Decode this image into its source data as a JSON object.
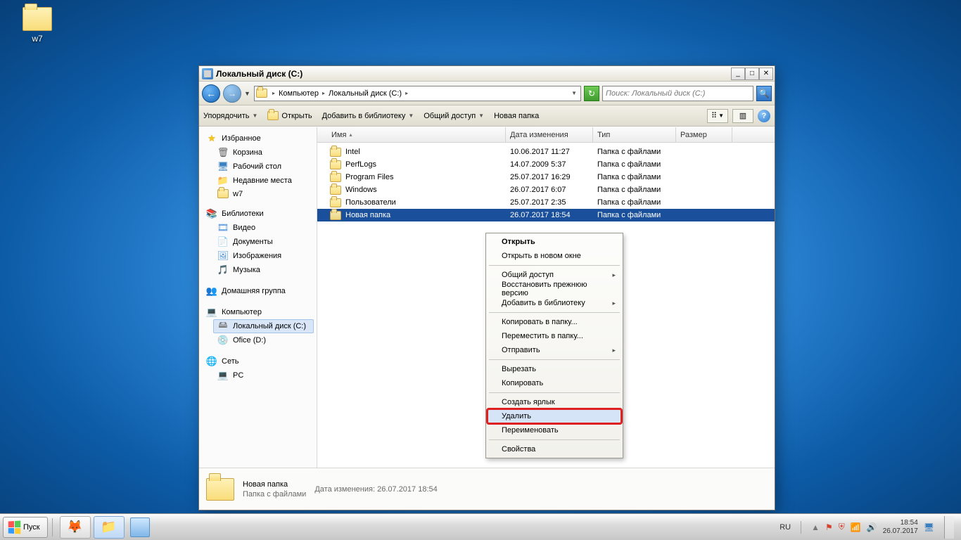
{
  "desktop": {
    "icon_label": "w7"
  },
  "window": {
    "title": "Локальный диск (C:)",
    "breadcrumb": {
      "root": "Компьютер",
      "disk": "Локальный диск (C:)"
    },
    "search_placeholder": "Поиск: Локальный диск (C:)"
  },
  "cmdbar": {
    "organize": "Упорядочить",
    "open": "Открыть",
    "add_lib": "Добавить в библиотеку",
    "share": "Общий доступ",
    "new_folder": "Новая папка"
  },
  "sidebar": {
    "favorites": {
      "head": "Избранное",
      "trash": "Корзина",
      "desktop": "Рабочий стол",
      "recent": "Недавние места",
      "w7": "w7"
    },
    "libraries": {
      "head": "Библиотеки",
      "video": "Видео",
      "docs": "Документы",
      "images": "Изображения",
      "music": "Музыка"
    },
    "homegroup": "Домашняя группа",
    "computer": {
      "head": "Компьютер",
      "c": "Локальный диск (C:)",
      "d": "Ofice (D:)"
    },
    "network": {
      "head": "Сеть",
      "pc": "PC"
    }
  },
  "columns": {
    "name": "Имя",
    "date": "Дата изменения",
    "type": "Тип",
    "size": "Размер"
  },
  "files": [
    {
      "name": "Intel",
      "date": "10.06.2017 11:27",
      "type": "Папка с файлами"
    },
    {
      "name": "PerfLogs",
      "date": "14.07.2009 5:37",
      "type": "Папка с файлами"
    },
    {
      "name": "Program Files",
      "date": "25.07.2017 16:29",
      "type": "Папка с файлами"
    },
    {
      "name": "Windows",
      "date": "26.07.2017 6:07",
      "type": "Папка с файлами"
    },
    {
      "name": "Пользователи",
      "date": "25.07.2017 2:35",
      "type": "Папка с файлами"
    },
    {
      "name": "Новая папка",
      "date": "26.07.2017 18:54",
      "type": "Папка с файлами"
    }
  ],
  "context_menu": {
    "open": "Открыть",
    "open_new": "Открыть в новом окне",
    "share": "Общий доступ",
    "restore": "Восстановить прежнюю версию",
    "add_lib": "Добавить в библиотеку",
    "copy_to": "Копировать в папку...",
    "move_to": "Переместить в папку...",
    "send_to": "Отправить",
    "cut": "Вырезать",
    "copy": "Копировать",
    "shortcut": "Создать ярлык",
    "delete": "Удалить",
    "rename": "Переименовать",
    "props": "Свойства"
  },
  "details": {
    "name": "Новая папка",
    "type": "Папка с файлами",
    "meta_label": "Дата изменения:",
    "meta_value": "26.07.2017 18:54"
  },
  "taskbar": {
    "start": "Пуск",
    "lang": "RU",
    "time": "18:54",
    "date": "26.07.2017"
  }
}
